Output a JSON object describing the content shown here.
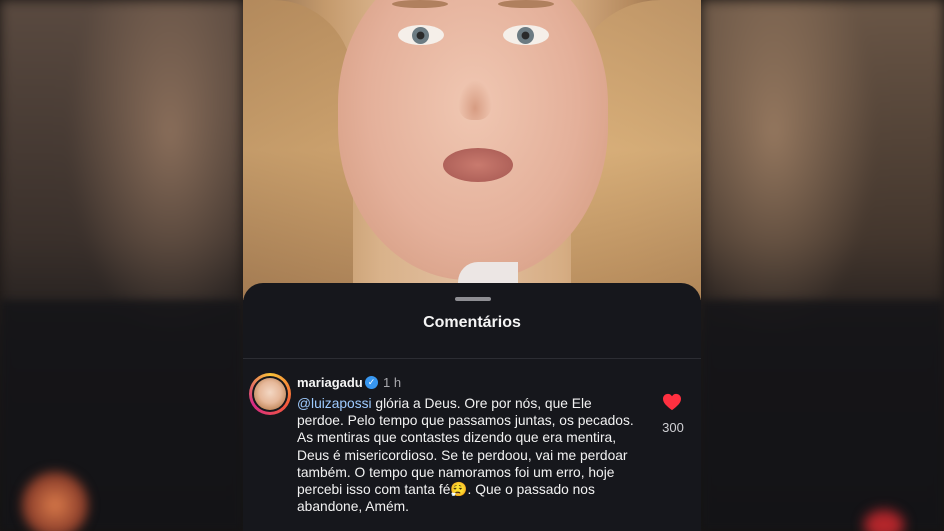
{
  "sheet": {
    "title": "Comentários"
  },
  "comment": {
    "username": "mariagadu",
    "verified_icon": "verified-badge-icon",
    "time": "1 h",
    "mention": "@luizapossi",
    "text": " glória a Deus.  Ore por nós, que Ele perdoe. Pelo tempo que passamos juntas, os pecados. As mentiras que contastes dizendo que era mentira, Deus é misericordioso. Se te perdoou, vai me perdoar também. O tempo que namoramos foi um erro, hoje percebi isso com tanta fé😮‍💨. Que o passado nos abandone,  Amém.",
    "likes": "300",
    "heart_color": "#ff3040"
  },
  "colors": {
    "sheet_background": "#16171c",
    "mention": "#9ecbff",
    "verified": "#3897f0"
  }
}
